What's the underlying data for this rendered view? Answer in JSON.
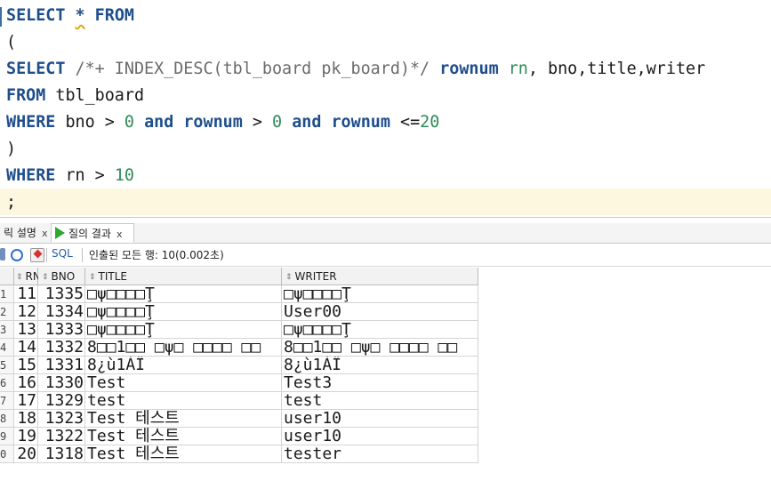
{
  "editor": {
    "line1": {
      "kw": "SELECT",
      "star": "*",
      "kw2": "FROM"
    },
    "line2": {
      "text": "("
    },
    "line3": {
      "kw": "SELECT",
      "hint": "/*+ INDEX_DESC(tbl_board pk_board)*/",
      "kw2": "rownum",
      "alias": "rn",
      "rest": ", bno,title,writer"
    },
    "line4": {
      "kw": "FROM",
      "rest": "tbl_board"
    },
    "line5": {
      "kw": "WHERE",
      "t1": "bno >",
      "n1": "0",
      "and1": "and",
      "rownum1": "rownum",
      "t2": ">",
      "n2": "0",
      "and2": "and",
      "rownum2": "rownum",
      "t3": "<=",
      "n3": "20"
    },
    "line6": {
      "text": ")"
    },
    "line7": {
      "kw": "WHERE",
      "t1": "rn >",
      "n1": "10"
    },
    "line8": {
      "text": ";"
    }
  },
  "tabs": {
    "inactive_label": "릭 설명",
    "inactive_close": "x",
    "active_label": "질의 결과",
    "active_close": "x"
  },
  "toolbar": {
    "sql_label": "SQL",
    "status": "인출된 모든 행: 10(0.002초)"
  },
  "grid": {
    "columns": [
      "RN",
      "BNO",
      "TITLE",
      "WRITER"
    ],
    "row_labels": [
      "1",
      "2",
      "3",
      "4",
      "5",
      "6",
      "7",
      "8",
      "9",
      "0"
    ],
    "rows": [
      {
        "rn": "11",
        "bno": "1335",
        "title": "□ψ□□□□Ţ",
        "writer": "□ψ□□□□Ţ"
      },
      {
        "rn": "12",
        "bno": "1334",
        "title": "□ψ□□□□Ţ",
        "writer": "User00"
      },
      {
        "rn": "13",
        "bno": "1333",
        "title": "□ψ□□□□Ţ",
        "writer": "□ψ□□□□Ţ"
      },
      {
        "rn": "14",
        "bno": "1332",
        "title": "8□□1□□ □ψ□ □□□□ □□",
        "writer": "8□□1□□ □ψ□ □□□□ □□"
      },
      {
        "rn": "15",
        "bno": "1331",
        "title": "8¿ù1ÀÏ",
        "writer": "8¿ù1ÀÏ"
      },
      {
        "rn": "16",
        "bno": "1330",
        "title": "Test",
        "writer": "Test3"
      },
      {
        "rn": "17",
        "bno": "1329",
        "title": "test",
        "writer": "test"
      },
      {
        "rn": "18",
        "bno": "1323",
        "title": "Test 테스트",
        "writer": "user10"
      },
      {
        "rn": "19",
        "bno": "1322",
        "title": "Test 테스트",
        "writer": "user10"
      },
      {
        "rn": "20",
        "bno": "1318",
        "title": "Test 테스트",
        "writer": "tester"
      }
    ]
  }
}
